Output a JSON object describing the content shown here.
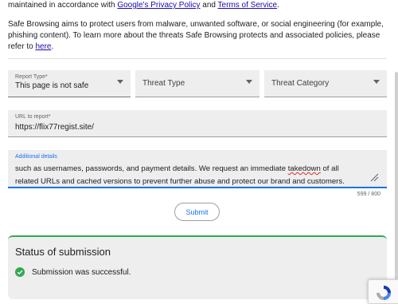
{
  "intro": {
    "prefix": "maintained in accordance with ",
    "privacy_link": "Google's Privacy Policy",
    "and": " and ",
    "terms_link": "Terms of Service",
    "suffix": "."
  },
  "description": {
    "text": "Safe Browsing aims to protect users from malware, unwanted software, or social engineering (for example, phishing content). To learn more about the threats Safe Browsing protects and associated policies, please refer to ",
    "link": "here",
    "suffix": "."
  },
  "form": {
    "report_type": {
      "label": "Report Type*",
      "value": "This page is not safe"
    },
    "threat_type": {
      "placeholder": "Threat Type"
    },
    "threat_category": {
      "placeholder": "Threat Category"
    },
    "url": {
      "label": "URL to report*",
      "value": "https://flix77regist.site/"
    },
    "details": {
      "label": "Additional details",
      "text_before": "such as usernames, passwords, and payment details. We request an immediate ",
      "text_flagged": "takedown",
      "text_after": " of all related URLs and cached versions to prevent further abuse and protect our brand and customers."
    },
    "char_counter": "599 / 800",
    "submit_label": "Submit"
  },
  "status": {
    "title": "Status of submission",
    "message": "Submission was successful."
  },
  "colors": {
    "accent": "#1a73e8",
    "success": "#34a853",
    "field_bg": "#eeeeee"
  }
}
